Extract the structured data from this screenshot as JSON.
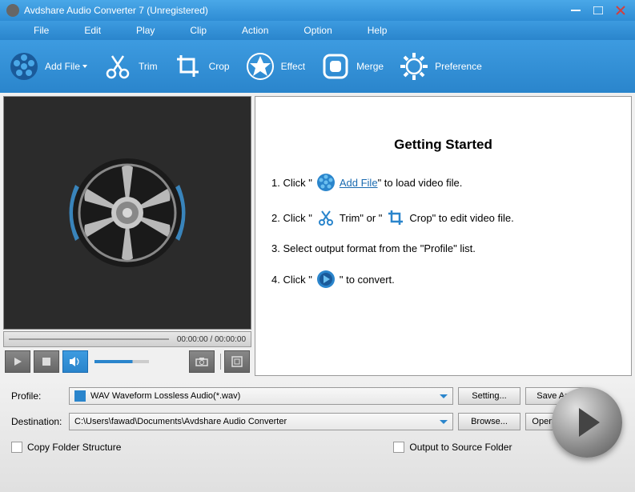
{
  "titlebar": {
    "title": "Avdshare Audio Converter 7 (Unregistered)"
  },
  "menu": [
    "File",
    "Edit",
    "Play",
    "Clip",
    "Action",
    "Option",
    "Help"
  ],
  "toolbar": [
    {
      "label": "Add File",
      "icon": "reel"
    },
    {
      "label": "Trim",
      "icon": "scissors"
    },
    {
      "label": "Crop",
      "icon": "crop"
    },
    {
      "label": "Effect",
      "icon": "star"
    },
    {
      "label": "Merge",
      "icon": "merge"
    },
    {
      "label": "Preference",
      "icon": "gear"
    }
  ],
  "preview": {
    "time": "00:00:00 / 00:00:00"
  },
  "content": {
    "heading": "Getting Started",
    "step1_a": "1. Click \"",
    "step1_link": "Add File",
    "step1_b": "\" to load video file.",
    "step2": "2. Click \"",
    "step2_trim": "Trim\" or \"",
    "step2_crop": "Crop\" to edit video file.",
    "step3": "3. Select output format from the \"Profile\" list.",
    "step4_a": "4. Click \"",
    "step4_b": "\" to convert."
  },
  "bottom": {
    "profile_label": "Profile:",
    "profile_value": "WAV Waveform Lossless Audio(*.wav)",
    "dest_label": "Destination:",
    "dest_value": "C:\\Users\\fawad\\Documents\\Avdshare Audio Converter",
    "setting": "Setting...",
    "save_as": "Save As...",
    "browse": "Browse...",
    "open_folder": "Open Folder",
    "copy_folder": "Copy Folder Structure",
    "output_source": "Output to Source Folder"
  }
}
